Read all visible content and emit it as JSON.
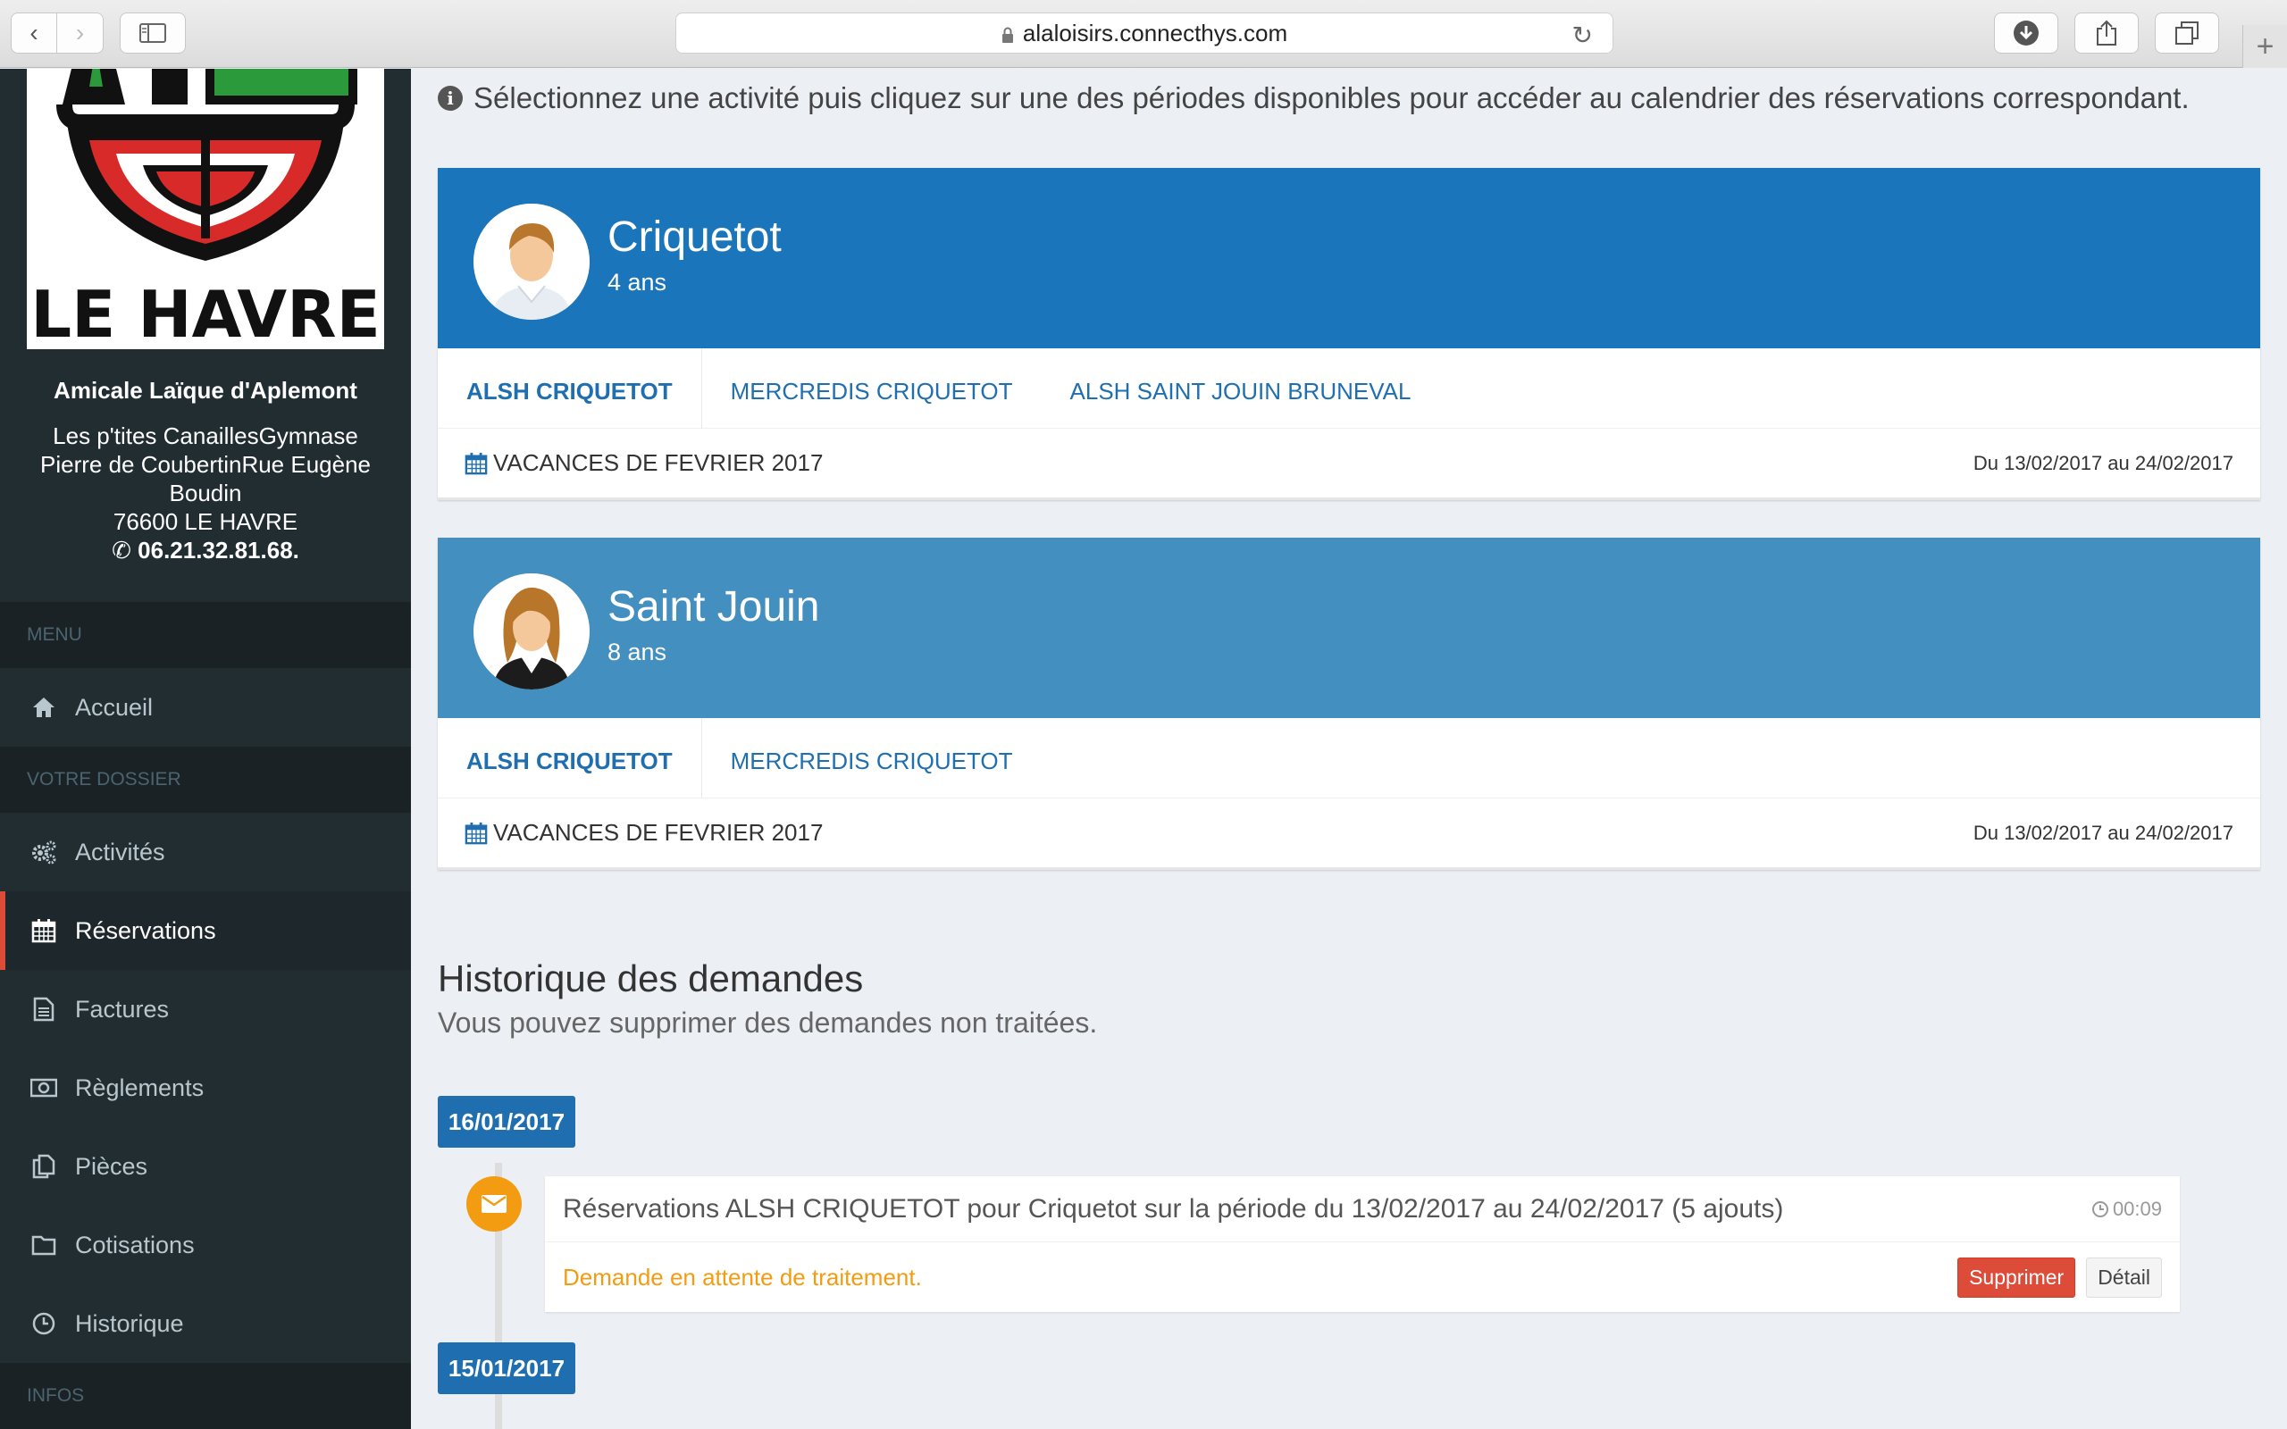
{
  "browser": {
    "url": "alaloisirs.connecthys.com",
    "back_glyph": "‹",
    "forward_glyph": "›",
    "new_tab_glyph": "+"
  },
  "org": {
    "logo_text": "LE HAVRE",
    "name": "Amicale Laïque d'Aplemont",
    "address_line1": "Les p'tites CanaillesGymnase",
    "address_line2": "Pierre de CoubertinRue Eugène",
    "address_line3": "Boudin",
    "address_line4": "76600 LE HAVRE",
    "phone": "06.21.32.81.68."
  },
  "sidebar": {
    "menu_header": "MENU",
    "accueil": "Accueil",
    "dossier_header": "VOTRE DOSSIER",
    "activites": "Activités",
    "reservations": "Réservations",
    "factures": "Factures",
    "reglements": "Règlements",
    "pieces": "Pièces",
    "cotisations": "Cotisations",
    "historique": "Historique",
    "infos_header": "INFOS"
  },
  "hint": "Sélectionnez une activité puis cliquez sur une des périodes disponibles pour accéder au calendrier des réservations correspondant.",
  "children": [
    {
      "name": "Criquetot",
      "age": "4 ans",
      "color": "#1b75bb",
      "tabs": [
        "ALSH CRIQUETOT",
        "MERCREDIS CRIQUETOT",
        "ALSH SAINT JOUIN BRUNEVAL"
      ],
      "period_name": "VACANCES DE FEVRIER 2017",
      "period_dates": "Du 13/02/2017 au 24/02/2017"
    },
    {
      "name": "Saint Jouin",
      "age": "8 ans",
      "color": "#428fc0",
      "tabs": [
        "ALSH CRIQUETOT",
        "MERCREDIS CRIQUETOT"
      ],
      "period_name": "VACANCES DE FEVRIER 2017",
      "period_dates": "Du 13/02/2017 au 24/02/2017"
    }
  ],
  "history": {
    "title": "Historique des demandes",
    "subtitle": "Vous pouvez supprimer des demandes non traitées.",
    "dates": [
      "16/01/2017",
      "15/01/2017"
    ],
    "item": {
      "title": "Réservations ALSH CRIQUETOT pour Criquetot sur la période du 13/02/2017 au 24/02/2017 (5 ajouts)",
      "time": "00:09",
      "status": "Demande en attente de traitement.",
      "delete_label": "Supprimer",
      "detail_label": "Détail"
    }
  }
}
